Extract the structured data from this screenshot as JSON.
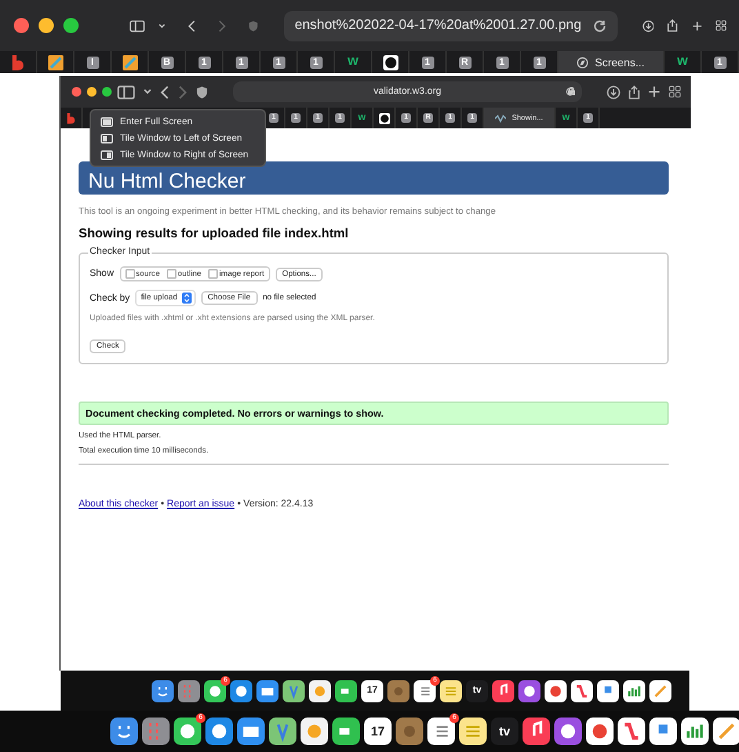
{
  "browser": {
    "url": "enshot%202022-04-17%20at%2001.27.00.png",
    "tabs": [
      {
        "kind": "b-logo",
        "selected": false
      },
      {
        "kind": "pencil",
        "selected": false
      },
      {
        "kind": "letter",
        "label": "I",
        "selected": false
      },
      {
        "kind": "pencil",
        "selected": false
      },
      {
        "kind": "letter",
        "label": "B",
        "selected": false
      },
      {
        "kind": "letter",
        "label": "1",
        "selected": false
      },
      {
        "kind": "letter",
        "label": "1",
        "selected": false
      },
      {
        "kind": "letter",
        "label": "1",
        "selected": false
      },
      {
        "kind": "letter",
        "label": "1",
        "selected": false
      },
      {
        "kind": "w",
        "label": "w",
        "selected": false
      },
      {
        "kind": "github",
        "selected": false
      },
      {
        "kind": "letter",
        "label": "1",
        "selected": false
      },
      {
        "kind": "letter",
        "label": "R",
        "selected": false
      },
      {
        "kind": "letter",
        "label": "1",
        "selected": false
      },
      {
        "kind": "letter",
        "label": "1",
        "selected": false
      },
      {
        "kind": "page",
        "label": "Screens...",
        "selected": true
      },
      {
        "kind": "w",
        "label": "w",
        "selected": false
      },
      {
        "kind": "letter",
        "label": "1",
        "selected": false
      }
    ]
  },
  "screenshot": {
    "browser": {
      "url": "validator.w3.org",
      "tabs_before_menu": [
        {
          "kind": "b-logo",
          "selected": false
        }
      ],
      "tabs_after_menu": [
        {
          "kind": "letter",
          "label": "1",
          "selected": false
        },
        {
          "kind": "letter",
          "label": "1",
          "selected": false
        },
        {
          "kind": "letter",
          "label": "1",
          "selected": false
        },
        {
          "kind": "letter",
          "label": "1",
          "selected": false
        },
        {
          "kind": "w",
          "label": "w",
          "selected": false
        },
        {
          "kind": "github",
          "selected": false
        },
        {
          "kind": "letter",
          "label": "1",
          "selected": false
        },
        {
          "kind": "letter",
          "label": "R",
          "selected": false
        },
        {
          "kind": "letter",
          "label": "1",
          "selected": false
        },
        {
          "kind": "letter",
          "label": "1",
          "selected": false
        },
        {
          "kind": "page",
          "label": "Showin...",
          "selected": true
        },
        {
          "kind": "w",
          "label": "w",
          "selected": false
        },
        {
          "kind": "letter",
          "label": "1",
          "selected": false
        }
      ]
    },
    "window_menu": [
      {
        "kind": "full",
        "label": "Enter Full Screen"
      },
      {
        "kind": "left",
        "label": "Tile Window to Left of Screen"
      },
      {
        "kind": "right",
        "label": "Tile Window to Right of Screen"
      }
    ],
    "page": {
      "title": "Nu Html Checker",
      "intro": "This tool is an ongoing experiment in better HTML checking, and its behavior remains subject to change",
      "heading": "Showing results for uploaded file index.html",
      "fieldset": {
        "legend": "Checker Input",
        "show_label": "Show",
        "show_options": [
          {
            "label": "source",
            "checked": false
          },
          {
            "label": "outline",
            "checked": false
          },
          {
            "label": "image report",
            "checked": false
          }
        ],
        "options_button": "Options...",
        "check_by_label": "Check by",
        "check_by_value": "file upload",
        "choose_file": "Choose File",
        "file_status": "no file selected",
        "note": "Uploaded files with .xhtml or .xht extensions are parsed using the XML parser.",
        "check_button": "Check"
      },
      "success": "Document checking completed. No errors or warnings to show.",
      "info": [
        "Used the HTML parser.",
        "Total execution time 10 milliseconds."
      ],
      "footer": {
        "about": "About this checker",
        "separator_1": "•",
        "report": "Report an issue",
        "separator_2": "•",
        "version": "Version: 22.4.13"
      }
    },
    "dock": [
      {
        "kind": "finder"
      },
      {
        "kind": "launchpad"
      },
      {
        "kind": "messages",
        "badge": "6"
      },
      {
        "kind": "safari"
      },
      {
        "kind": "mail"
      },
      {
        "kind": "maps"
      },
      {
        "kind": "photos"
      },
      {
        "kind": "facetime"
      },
      {
        "kind": "calendar",
        "text": "17"
      },
      {
        "kind": "contacts"
      },
      {
        "kind": "reminders",
        "badge": "6"
      },
      {
        "kind": "notes"
      },
      {
        "kind": "tv",
        "text": "tv"
      },
      {
        "kind": "music"
      },
      {
        "kind": "podcasts"
      },
      {
        "kind": "chrome"
      },
      {
        "kind": "news"
      },
      {
        "kind": "keynote"
      },
      {
        "kind": "numbers"
      },
      {
        "kind": "pages"
      }
    ]
  },
  "dock": [
    {
      "kind": "finder"
    },
    {
      "kind": "launchpad"
    },
    {
      "kind": "messages",
      "badge": "6"
    },
    {
      "kind": "safari"
    },
    {
      "kind": "mail"
    },
    {
      "kind": "maps"
    },
    {
      "kind": "photos"
    },
    {
      "kind": "facetime"
    },
    {
      "kind": "calendar",
      "text": "17"
    },
    {
      "kind": "contacts"
    },
    {
      "kind": "reminders",
      "badge": "6"
    },
    {
      "kind": "notes"
    },
    {
      "kind": "tv",
      "text": "tv"
    },
    {
      "kind": "music"
    },
    {
      "kind": "podcasts"
    },
    {
      "kind": "chrome"
    },
    {
      "kind": "news"
    },
    {
      "kind": "keynote"
    },
    {
      "kind": "numbers"
    },
    {
      "kind": "pages"
    }
  ]
}
